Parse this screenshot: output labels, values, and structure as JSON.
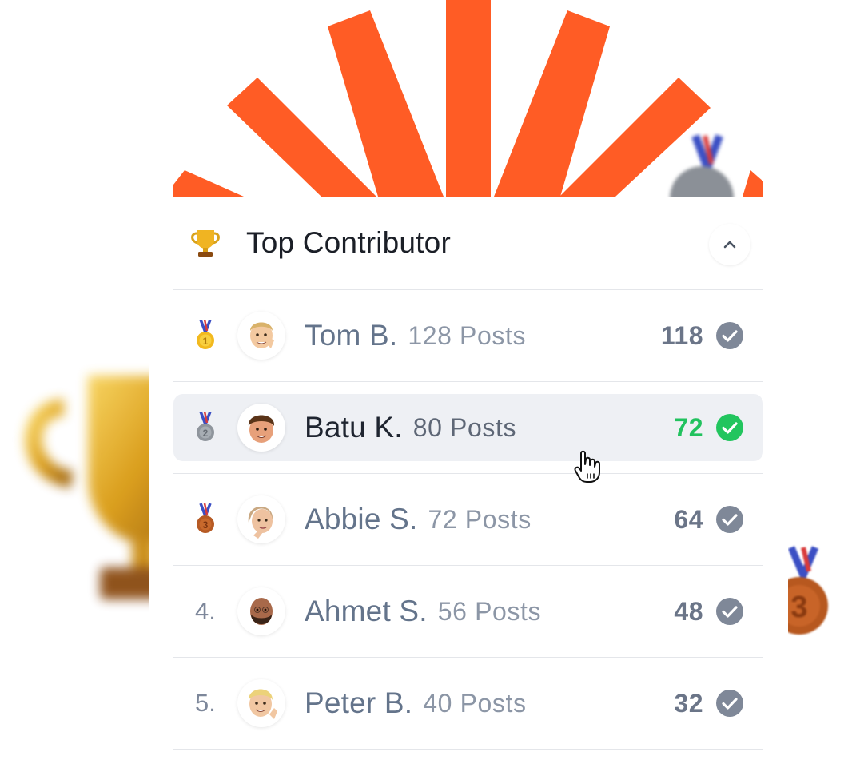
{
  "colors": {
    "accent_orange": "#ff5c25",
    "verified_active": "#22c55e",
    "verified_inactive": "#7f8898"
  },
  "leaderboard": {
    "title": "Top Contributor",
    "icon": "trophy-icon",
    "collapse_icon": "chevron-up-icon",
    "rows": [
      {
        "rank": "1",
        "medal": "gold-medal-icon",
        "name": "Tom B.",
        "posts": "128 Posts",
        "score": "118",
        "active": false
      },
      {
        "rank": "2",
        "medal": "silver-medal-icon",
        "name": "Batu K.",
        "posts": "80 Posts",
        "score": "72",
        "active": true
      },
      {
        "rank": "3",
        "medal": "bronze-medal-icon",
        "name": "Abbie S.",
        "posts": "72 Posts",
        "score": "64",
        "active": false
      },
      {
        "rank": "4.",
        "medal": null,
        "name": "Ahmet S.",
        "posts": "56 Posts",
        "score": "48",
        "active": false
      },
      {
        "rank": "5.",
        "medal": null,
        "name": "Peter B.",
        "posts": "40 Posts",
        "score": "32",
        "active": false
      }
    ]
  }
}
